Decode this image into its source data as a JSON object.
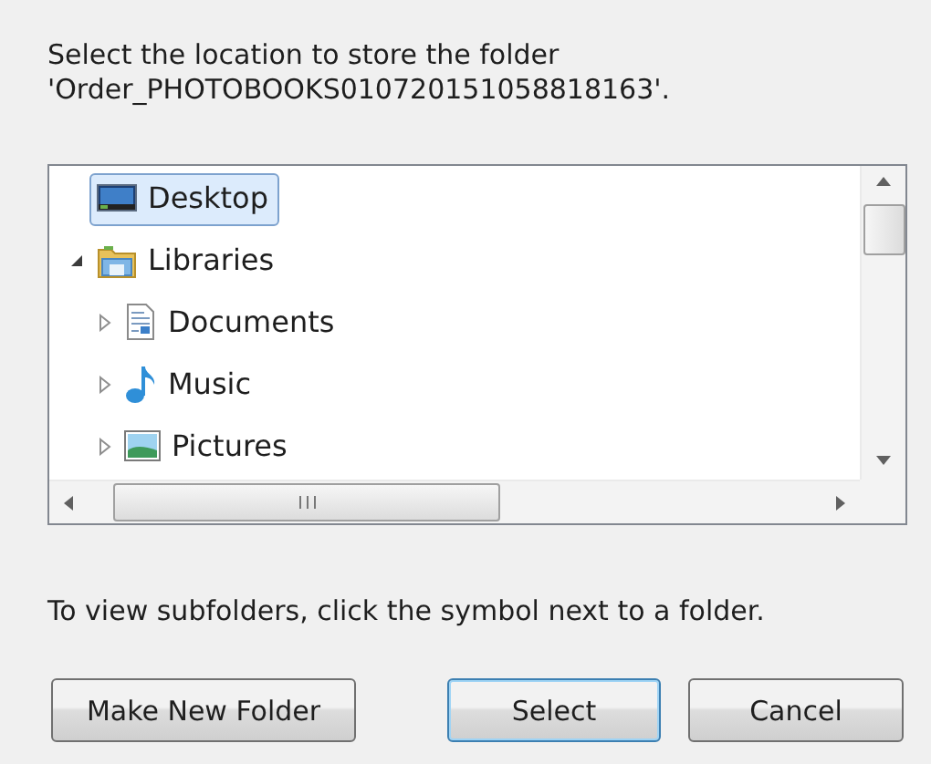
{
  "prompt": [
    "Select the location to store the folder",
    "'Order_PHOTOBOOKS010720151058818163'."
  ],
  "tree": [
    {
      "label": "Desktop",
      "kind": "desktop",
      "selected": true,
      "expandable": false,
      "expanded": false
    },
    {
      "label": "Libraries",
      "kind": "library",
      "selected": false,
      "expandable": true,
      "expanded": true,
      "children": [
        {
          "label": "Documents",
          "kind": "documents",
          "selected": false,
          "expandable": true,
          "expanded": false
        },
        {
          "label": "Music",
          "kind": "music",
          "selected": false,
          "expandable": true,
          "expanded": false
        },
        {
          "label": "Pictures",
          "kind": "pictures",
          "selected": false,
          "expandable": true,
          "expanded": false
        }
      ]
    }
  ],
  "hint": "To view subfolders, click the symbol next to a folder.",
  "buttons": [
    {
      "label": "Make New Folder",
      "default": false
    },
    {
      "label": "Select",
      "default": true
    },
    {
      "label": "Cancel",
      "default": false
    }
  ]
}
